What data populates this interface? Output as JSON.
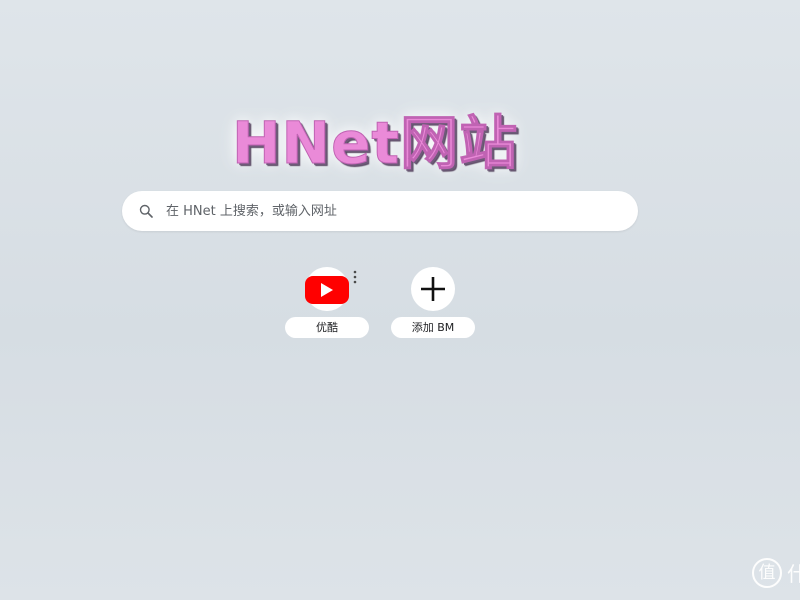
{
  "brand": {
    "logo_text": "HNet网站",
    "logo_color": "#ea8ad8"
  },
  "search": {
    "placeholder": "在 HNet 上搜索，或输入网址",
    "value": "",
    "icon": "search-icon"
  },
  "shortcuts": [
    {
      "label": "优酷",
      "icon": "youtube-icon",
      "icon_color": "#ff0000",
      "has_menu": true
    },
    {
      "label": "添加 BM",
      "icon": "plus-icon"
    }
  ],
  "watermark": {
    "glyph": "值",
    "extra_glyph": "什"
  }
}
